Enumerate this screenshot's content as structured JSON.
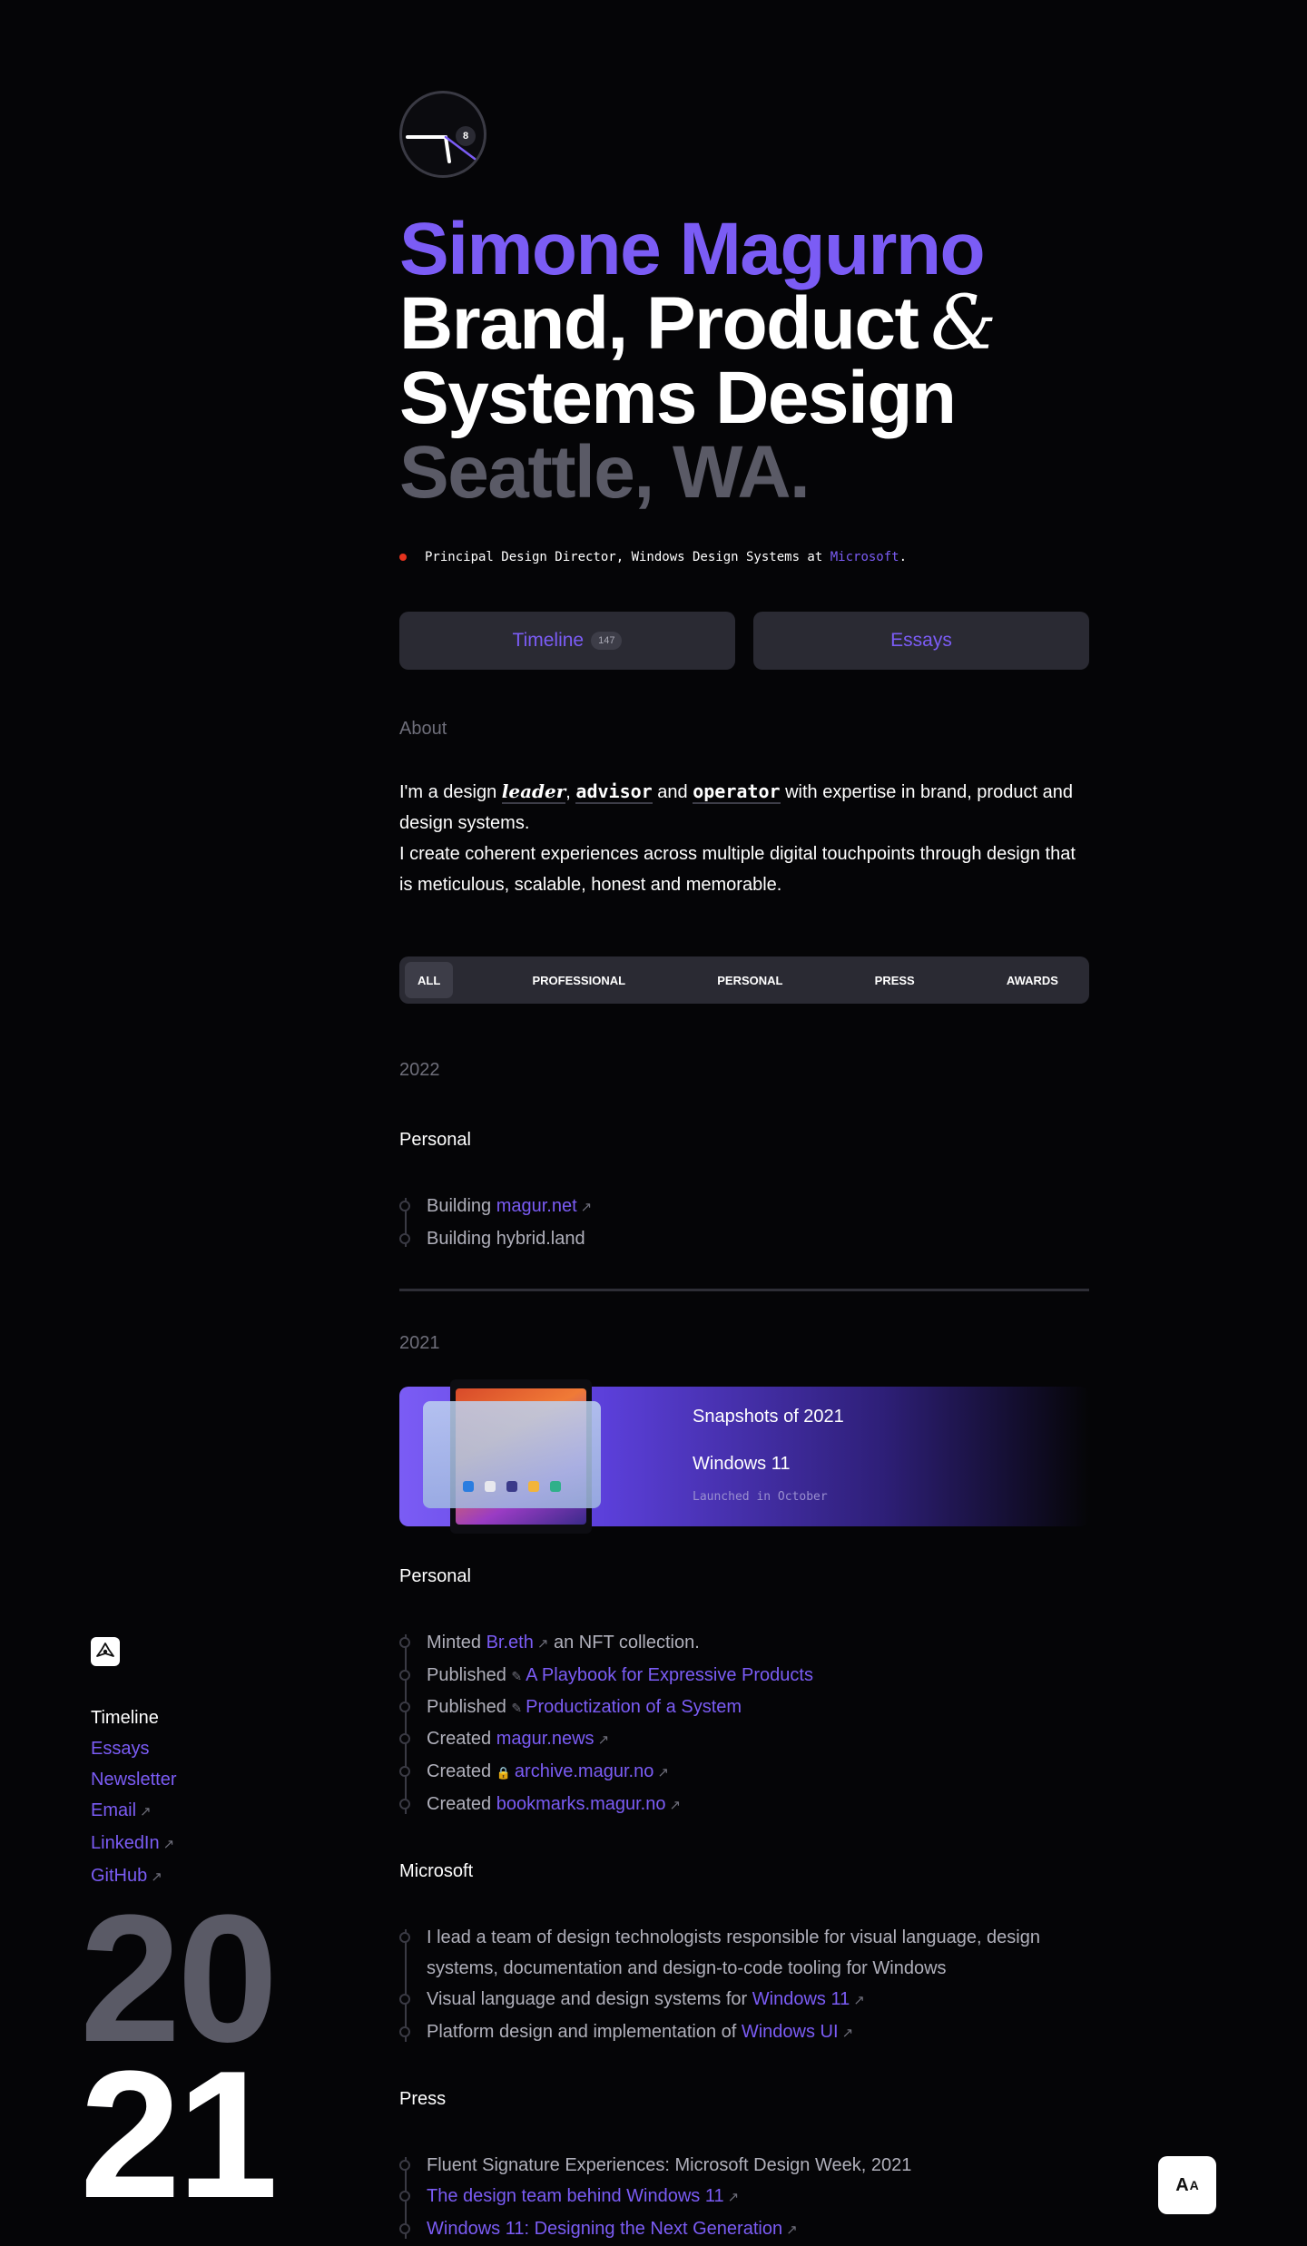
{
  "clock": {
    "badge": "8"
  },
  "hero": {
    "name": "Simone Magurno",
    "line2_text": "Brand, Product",
    "line2_amp": "&",
    "line3": "Systems Design",
    "line4": "Seattle, WA."
  },
  "role": {
    "text": "Principal Design Director, Windows Design Systems at ",
    "link": "Microsoft",
    "end": "."
  },
  "tabs": [
    {
      "label": "Timeline",
      "count": "147"
    },
    {
      "label": "Essays"
    }
  ],
  "about": {
    "heading": "About",
    "p1_a": "I'm a design ",
    "w1": "leader",
    "p1_b": ", ",
    "w2": "advisor",
    "p1_c": " and ",
    "w3": "operator",
    "p1_d": " with expertise in brand, product and design systems.",
    "p2": "I create coherent experiences across multiple digital touchpoints through design that is meticulous, scalable, honest and memorable."
  },
  "filters": [
    "ALL",
    "PROFESSIONAL",
    "PERSONAL",
    "PRESS",
    "AWARDS"
  ],
  "y2022": {
    "year": "2022",
    "section": "Personal",
    "e1_pre": "Building ",
    "e1_link": "magur.net",
    "e2": "Building hybrid.land"
  },
  "y2021": {
    "year": "2021",
    "snapshot": {
      "title": "Snapshots of 2021",
      "item": "Windows 11",
      "caption": "Launched in October"
    },
    "personal": {
      "section": "Personal",
      "e1_pre": "Minted ",
      "e1_link": "Br.eth",
      "e1_post": " an NFT collection.",
      "e2_pre": "Published ",
      "e2_link": "A Playbook for Expressive Products",
      "e3_pre": "Published ",
      "e3_link": "Productization of a System",
      "e4_pre": "Created ",
      "e4_link": "magur.news",
      "e5_pre": "Created ",
      "e5_link": "archive.magur.no",
      "e6_pre": "Created ",
      "e6_link": "bookmarks.magur.no"
    },
    "microsoft": {
      "section": "Microsoft",
      "summary": "I lead a team of design technologists responsible for visual language, design systems, documentation and design-to-code tooling for Windows",
      "e1_pre": "Visual language and design systems for ",
      "e1_link": "Windows 11",
      "e2_pre": "Platform design and implementation of ",
      "e2_link": "Windows UI"
    },
    "press": {
      "section": "Press",
      "e1": "Fluent Signature Experiences: Microsoft Design Week, 2021",
      "e2_link": "The design team behind Windows 11",
      "e3_link": "Windows 11: Designing the Next Generation"
    }
  },
  "nav": [
    {
      "label": "Timeline",
      "current": true
    },
    {
      "label": "Essays"
    },
    {
      "label": "Newsletter"
    },
    {
      "label": "Email",
      "external": true
    },
    {
      "label": "LinkedIn",
      "external": true
    },
    {
      "label": "GitHub",
      "external": true
    }
  ],
  "big_year": {
    "top": "20",
    "bottom": "21"
  },
  "font_toggle": {
    "big": "A",
    "small": "A"
  },
  "icons": {
    "external": "↗",
    "pen": "✎",
    "lock": "🔒"
  },
  "colors": {
    "accent": "#7b5cf5",
    "muted": "#5a5a66",
    "background": "#050507",
    "red_dot": "#e5331e"
  }
}
